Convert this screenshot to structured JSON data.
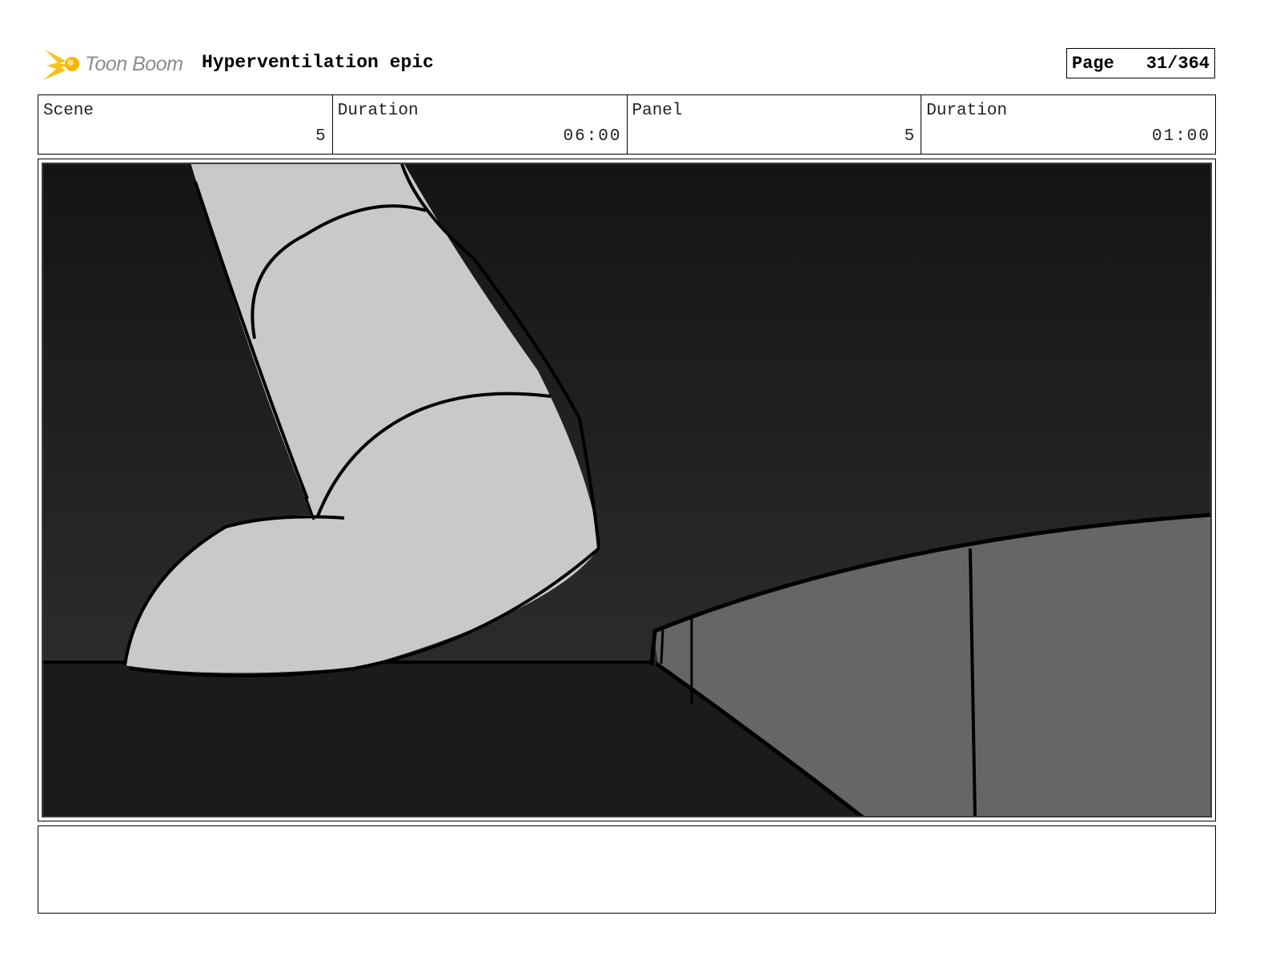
{
  "header": {
    "logo_text": "Toon Boom",
    "project_title": "Hyperventilation epic",
    "page_label": "Page",
    "page_value": "31/364"
  },
  "info": [
    {
      "label": "Scene",
      "value": "5"
    },
    {
      "label": "Duration",
      "value": "06:00"
    },
    {
      "label": "Panel",
      "value": "5"
    },
    {
      "label": "Duration",
      "value": "01:00"
    }
  ],
  "notes": {
    "text": ""
  },
  "colors": {
    "logo_yellow": "#f7c21b",
    "background_top": "#161616",
    "floor": "#1b1b1b",
    "leg_fill": "#c9c9c9",
    "object_fill": "#666666"
  }
}
